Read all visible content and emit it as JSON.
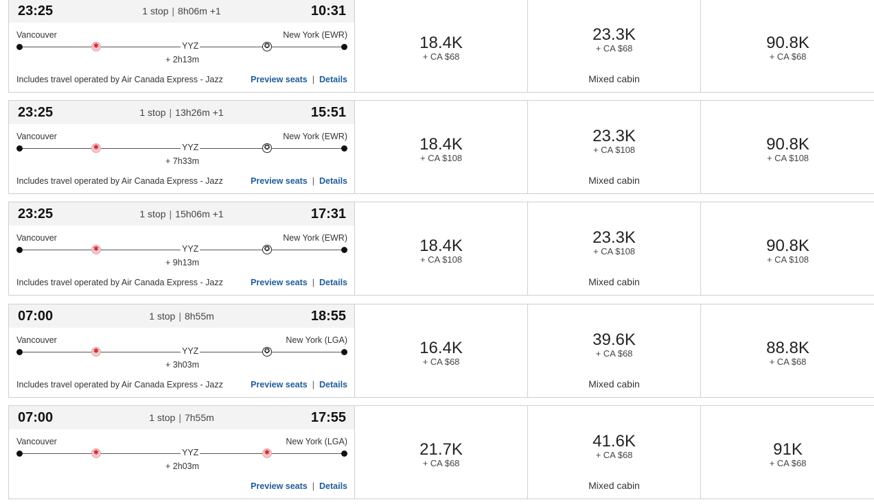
{
  "flights": [
    {
      "departure_time": "23:25",
      "stops": "1 stop",
      "duration": "8h06m +1",
      "arrival_time": "10:31",
      "origin": "Vancouver",
      "destination": "New York (EWR)",
      "stop_code": "YYZ",
      "layover": "+ 2h13m",
      "operated_by": "Includes travel operated by Air Canada Express - Jazz",
      "second_leg_carrier": "star-alliance-icon",
      "preview_seats": "Preview seats",
      "details": "Details",
      "fares": [
        {
          "points": "18.4K",
          "taxes": "+ CA $68",
          "note": ""
        },
        {
          "points": "23.3K",
          "taxes": "+ CA $68",
          "note": "Mixed cabin"
        },
        {
          "points": "90.8K",
          "taxes": "+ CA $68",
          "note": ""
        }
      ]
    },
    {
      "departure_time": "23:25",
      "stops": "1 stop",
      "duration": "13h26m +1",
      "arrival_time": "15:51",
      "origin": "Vancouver",
      "destination": "New York (EWR)",
      "stop_code": "YYZ",
      "layover": "+ 7h33m",
      "operated_by": "Includes travel operated by Air Canada Express - Jazz",
      "second_leg_carrier": "star-alliance-icon",
      "preview_seats": "Preview seats",
      "details": "Details",
      "fares": [
        {
          "points": "18.4K",
          "taxes": "+ CA $108",
          "note": ""
        },
        {
          "points": "23.3K",
          "taxes": "+ CA $108",
          "note": "Mixed cabin"
        },
        {
          "points": "90.8K",
          "taxes": "+ CA $108",
          "note": ""
        }
      ]
    },
    {
      "departure_time": "23:25",
      "stops": "1 stop",
      "duration": "15h06m +1",
      "arrival_time": "17:31",
      "origin": "Vancouver",
      "destination": "New York (EWR)",
      "stop_code": "YYZ",
      "layover": "+ 9h13m",
      "operated_by": "Includes travel operated by Air Canada Express - Jazz",
      "second_leg_carrier": "star-alliance-icon",
      "preview_seats": "Preview seats",
      "details": "Details",
      "fares": [
        {
          "points": "18.4K",
          "taxes": "+ CA $108",
          "note": ""
        },
        {
          "points": "23.3K",
          "taxes": "+ CA $108",
          "note": "Mixed cabin"
        },
        {
          "points": "90.8K",
          "taxes": "+ CA $108",
          "note": ""
        }
      ]
    },
    {
      "departure_time": "07:00",
      "stops": "1 stop",
      "duration": "8h55m",
      "arrival_time": "18:55",
      "origin": "Vancouver",
      "destination": "New York (LGA)",
      "stop_code": "YYZ",
      "layover": "+ 3h03m",
      "operated_by": "Includes travel operated by Air Canada Express - Jazz",
      "second_leg_carrier": "star-alliance-icon",
      "preview_seats": "Preview seats",
      "details": "Details",
      "fares": [
        {
          "points": "16.4K",
          "taxes": "+ CA $68",
          "note": ""
        },
        {
          "points": "39.6K",
          "taxes": "+ CA $68",
          "note": "Mixed cabin"
        },
        {
          "points": "88.8K",
          "taxes": "+ CA $68",
          "note": ""
        }
      ]
    },
    {
      "departure_time": "07:00",
      "stops": "1 stop",
      "duration": "7h55m",
      "arrival_time": "17:55",
      "origin": "Vancouver",
      "destination": "New York (LGA)",
      "stop_code": "YYZ",
      "layover": "+ 2h03m",
      "operated_by": "",
      "second_leg_carrier": "maple-leaf-icon",
      "preview_seats": "Preview seats",
      "details": "Details",
      "fares": [
        {
          "points": "21.7K",
          "taxes": "+ CA $68",
          "note": ""
        },
        {
          "points": "41.6K",
          "taxes": "+ CA $68",
          "note": "Mixed cabin"
        },
        {
          "points": "91K",
          "taxes": "+ CA $68",
          "note": ""
        }
      ]
    }
  ],
  "colors": {
    "link": "#1f5c99",
    "brand_red": "#d2232a",
    "header_bg": "#f3f3f3",
    "border": "#cfcfcf"
  }
}
